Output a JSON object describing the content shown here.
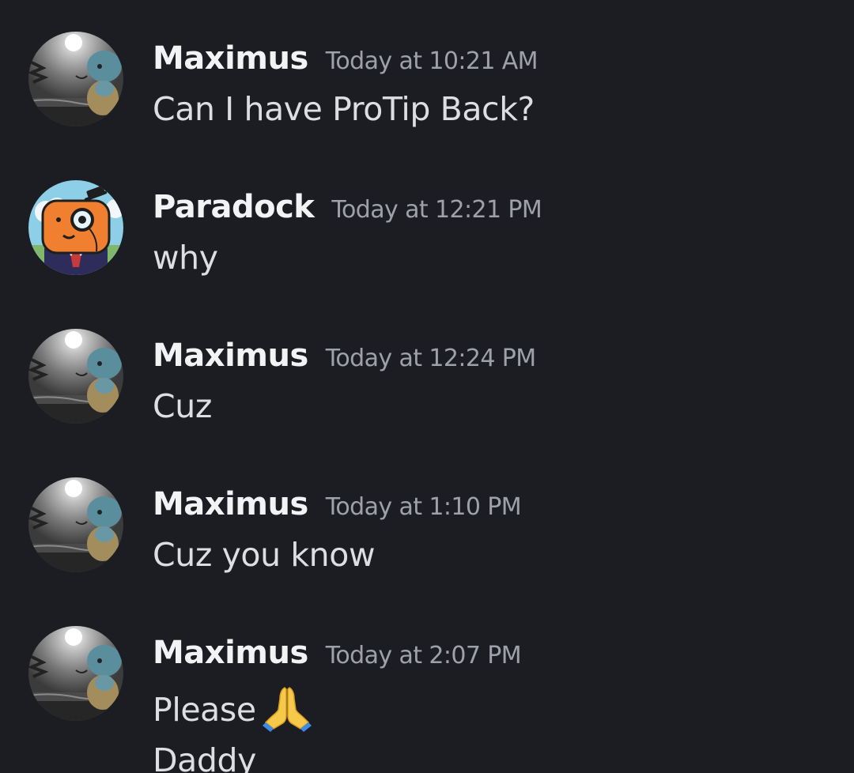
{
  "messages": [
    {
      "username": "Maximus",
      "timestamp": "Today at 10:21 AM",
      "text": "Can I have ProTip Back?",
      "avatar": "squirtle-moon-avatar"
    },
    {
      "username": "Paradock",
      "timestamp": "Today at 12:21 PM",
      "text": "why",
      "avatar": "orange-monocle-avatar"
    },
    {
      "username": "Maximus",
      "timestamp": "Today at 12:24 PM",
      "text": "Cuz",
      "avatar": "squirtle-moon-avatar"
    },
    {
      "username": "Maximus",
      "timestamp": "Today at 1:10 PM",
      "text": "Cuz you know",
      "avatar": "squirtle-moon-avatar"
    },
    {
      "username": "Maximus",
      "timestamp": "Today at 2:07 PM",
      "text": "Please",
      "emoji": "folded-hands-emoji",
      "followup_text": "Daddy",
      "avatar": "squirtle-moon-avatar"
    }
  ],
  "colors": {
    "background": "#1c1d22",
    "username": "#f2f3f5",
    "timestamp": "#9ea1a9",
    "message_text": "#dcdee3"
  }
}
